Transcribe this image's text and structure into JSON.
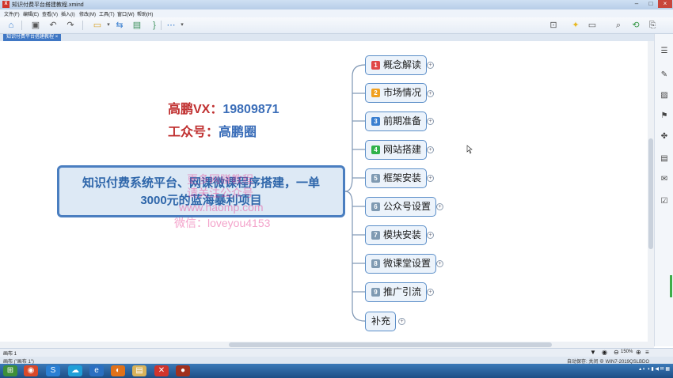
{
  "window": {
    "title": "知识付费平台搭建教程.xmind",
    "app_badge": "X"
  },
  "menu": [
    "文件(F)",
    "编辑(E)",
    "查看(V)",
    "插入(I)",
    "修改(M)",
    "工具(T)",
    "窗口(W)",
    "帮助(H)"
  ],
  "tab": {
    "label": "知识付费平台搭建教程",
    "close": "×"
  },
  "annotations": {
    "vx_label": "高鹏VX：",
    "vx_number": "19809871",
    "gzh_label": "工众号：",
    "gzh_name": "高鹏圈"
  },
  "central_topic": {
    "line1": "知识付费系统平台、网课微课程序搭建，一单",
    "line2": "3000元的蓝海暴利项目"
  },
  "branches": [
    {
      "num": "1",
      "label": "概念解读",
      "color": "#e04848"
    },
    {
      "num": "2",
      "label": "市场情况",
      "color": "#f0a020"
    },
    {
      "num": "3",
      "label": "前期准备",
      "color": "#3a7fd0"
    },
    {
      "num": "4",
      "label": "网站搭建",
      "color": "#2fb24a"
    },
    {
      "num": "5",
      "label": "框架安装",
      "color": "#7f9ab2"
    },
    {
      "num": "6",
      "label": "公众号设置",
      "color": "#7f9ab2"
    },
    {
      "num": "7",
      "label": "模块安装",
      "color": "#7f9ab2"
    },
    {
      "num": "8",
      "label": "微课堂设置",
      "color": "#7f9ab2"
    },
    {
      "num": "9",
      "label": "推广引流",
      "color": "#7f9ab2"
    },
    {
      "num": "",
      "label": "补充",
      "color": ""
    }
  ],
  "watermark": {
    "line1": "更多网赚教程",
    "line2": "请关注公众号",
    "line3": "www.haomp.com",
    "line4": "微信：loveyou4153"
  },
  "sheet_tab": "画布 1",
  "status": {
    "left": "画布 (\"画布 1\")",
    "zoom": "150%",
    "right": "自动保存: 关闭  ⊕ WIN7-2019QSLBDO"
  },
  "icons": {
    "accent": "#4a7ec0"
  }
}
